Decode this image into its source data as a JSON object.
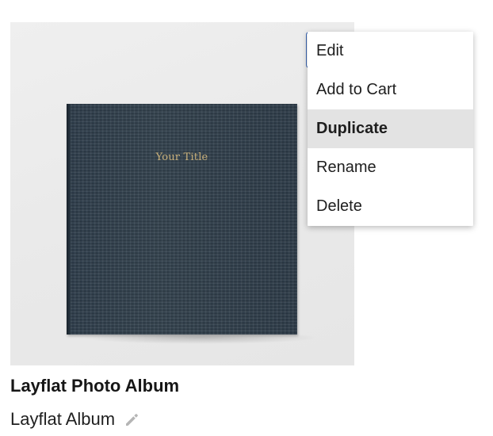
{
  "product": {
    "cover_title": "Your Title",
    "name": "Layflat Photo Album",
    "album_name": "Layflat Album",
    "edit_icon": "pencil-icon"
  },
  "context_menu": {
    "items": [
      {
        "label": "Edit",
        "active": false
      },
      {
        "label": "Add to Cart",
        "active": false
      },
      {
        "label": "Duplicate",
        "active": true
      },
      {
        "label": "Rename",
        "active": false
      },
      {
        "label": "Delete",
        "active": false
      }
    ]
  },
  "colors": {
    "cover": "#2d3b48",
    "foil": "#c9b07a",
    "menu_highlight": "#e3e3e3",
    "anchor_border": "#3a66b4"
  }
}
